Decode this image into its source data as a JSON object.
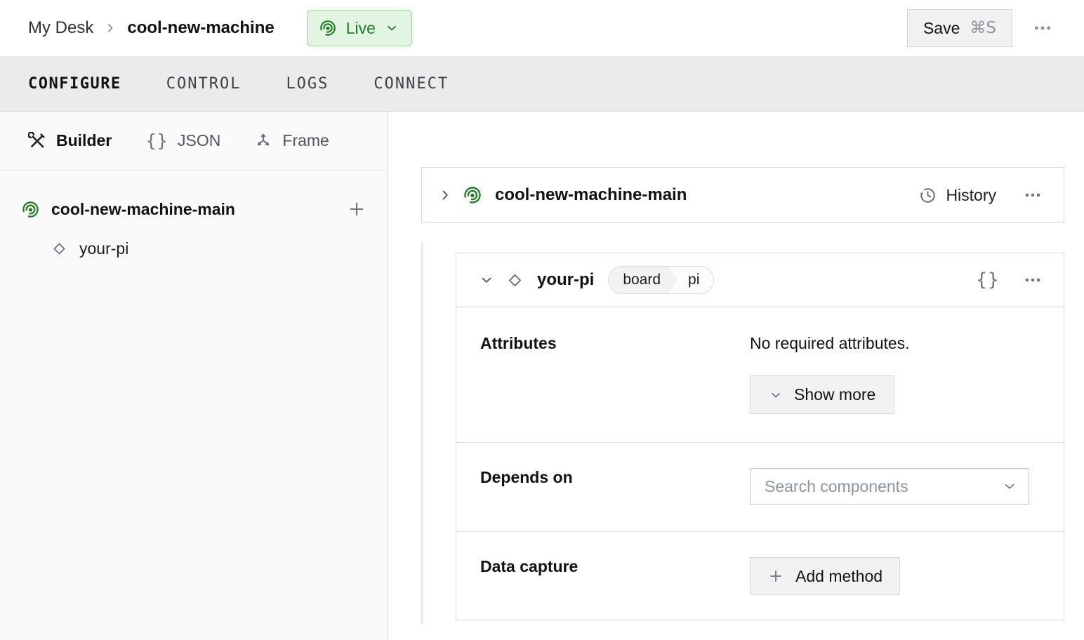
{
  "header": {
    "breadcrumb": {
      "parent": "My Desk",
      "current": "cool-new-machine"
    },
    "status": {
      "label": "Live"
    },
    "save": {
      "label": "Save",
      "shortcut": "⌘S"
    }
  },
  "tabs": {
    "items": [
      {
        "label": "CONFIGURE",
        "active": true
      },
      {
        "label": "CONTROL",
        "active": false
      },
      {
        "label": "LOGS",
        "active": false
      },
      {
        "label": "CONNECT",
        "active": false
      }
    ]
  },
  "sidebar": {
    "modes": [
      {
        "label": "Builder",
        "icon": "crossed-tools-icon",
        "active": true
      },
      {
        "label": "JSON",
        "icon": "braces-icon",
        "glyph": "{}",
        "active": false
      },
      {
        "label": "Frame",
        "icon": "axes-icon",
        "active": false
      }
    ],
    "tree": {
      "root": {
        "label": "cool-new-machine-main",
        "icon": "broadcast-icon"
      },
      "children": [
        {
          "label": "your-pi",
          "icon": "diamond-icon"
        }
      ]
    }
  },
  "main": {
    "machine_card": {
      "title": "cool-new-machine-main",
      "history_label": "History"
    },
    "component_card": {
      "title": "your-pi",
      "type_badge": {
        "type": "board",
        "model": "pi"
      },
      "code_glyph": "{}",
      "attributes": {
        "label": "Attributes",
        "empty_text": "No required attributes.",
        "show_more_label": "Show more"
      },
      "depends_on": {
        "label": "Depends on",
        "placeholder": "Search components"
      },
      "data_capture": {
        "label": "Data capture",
        "add_method_label": "Add method"
      }
    }
  },
  "colors": {
    "accent-green": "#217a24",
    "live-bg": "#e2f4e2",
    "live-border": "#9ad49a",
    "tabbar-bg": "#ebebec",
    "card-border": "#d7d7d7",
    "button-bg": "#f2f2f2",
    "button-border": "#d9d9d9",
    "muted": "#6b7280",
    "placeholder": "#8e959e"
  }
}
